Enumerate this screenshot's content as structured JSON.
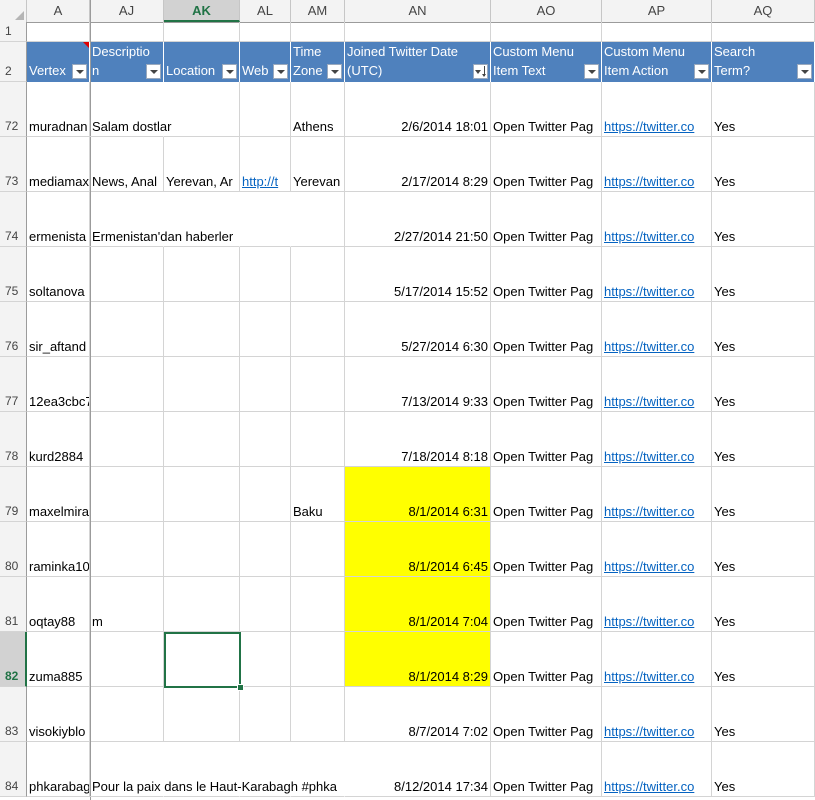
{
  "columns": [
    {
      "letter": "A",
      "selected": false
    },
    {
      "letter": "AJ",
      "selected": false
    },
    {
      "letter": "AK",
      "selected": true
    },
    {
      "letter": "AL",
      "selected": false
    },
    {
      "letter": "AM",
      "selected": false
    },
    {
      "letter": "AN",
      "selected": false
    },
    {
      "letter": "AO",
      "selected": false
    },
    {
      "letter": "AP",
      "selected": false
    },
    {
      "letter": "AQ",
      "selected": false
    }
  ],
  "row1_label": "1",
  "row2_label": "2",
  "headers": [
    {
      "label": "Vertex",
      "filter": true,
      "sorted": false
    },
    {
      "label": "Descriptio\nn",
      "filter": true,
      "sorted": false
    },
    {
      "label": "Location",
      "filter": true,
      "sorted": false
    },
    {
      "label": "Web",
      "filter": true,
      "sorted": false
    },
    {
      "label": "Time\nZone",
      "filter": true,
      "sorted": false
    },
    {
      "label": "Joined Twitter Date\n(UTC)",
      "filter": true,
      "sorted": true
    },
    {
      "label": "Custom Menu\nItem Text",
      "filter": true,
      "sorted": false
    },
    {
      "label": "Custom Menu\nItem Action",
      "filter": true,
      "sorted": false
    },
    {
      "label": "Tweeted Search\nTerm?",
      "filter": true,
      "sorted": false
    }
  ],
  "rows": [
    {
      "num": "72",
      "vertex": "muradnan",
      "description": "Salam dostlar",
      "location": "",
      "web": "",
      "timezone": "Athens",
      "joined": "2/6/2014 18:01",
      "menu_text": "Open Twitter Pag",
      "menu_action": "https://twitter.co",
      "tweeted": "Yes",
      "highlight": false
    },
    {
      "num": "73",
      "vertex": "mediamax",
      "description": "News, Anal",
      "location": "Yerevan, Ar",
      "web": "http://t",
      "timezone": "Yerevan",
      "joined": "2/17/2014 8:29",
      "menu_text": "Open Twitter Pag",
      "menu_action": "https://twitter.co",
      "tweeted": "Yes",
      "highlight": false
    },
    {
      "num": "74",
      "vertex": "ermenista",
      "description": "Ermenistan'dan haberler",
      "location": "",
      "web": "",
      "timezone": "",
      "joined": "2/27/2014 21:50",
      "menu_text": "Open Twitter Pag",
      "menu_action": "https://twitter.co",
      "tweeted": "Yes",
      "highlight": false
    },
    {
      "num": "75",
      "vertex": "soltanova",
      "description": "",
      "location": "",
      "web": "",
      "timezone": "",
      "joined": "5/17/2014 15:52",
      "menu_text": "Open Twitter Pag",
      "menu_action": "https://twitter.co",
      "tweeted": "Yes",
      "highlight": false
    },
    {
      "num": "76",
      "vertex": "sir_aftand",
      "description": "",
      "location": "",
      "web": "",
      "timezone": "",
      "joined": "5/27/2014 6:30",
      "menu_text": "Open Twitter Pag",
      "menu_action": "https://twitter.co",
      "tweeted": "Yes",
      "highlight": false
    },
    {
      "num": "77",
      "vertex": "12ea3cbc7",
      "description": "",
      "location": "",
      "web": "",
      "timezone": "",
      "joined": "7/13/2014 9:33",
      "menu_text": "Open Twitter Pag",
      "menu_action": "https://twitter.co",
      "tweeted": "Yes",
      "highlight": false
    },
    {
      "num": "78",
      "vertex": "kurd2884",
      "description": "",
      "location": "",
      "web": "",
      "timezone": "",
      "joined": "7/18/2014 8:18",
      "menu_text": "Open Twitter Pag",
      "menu_action": "https://twitter.co",
      "tweeted": "Yes",
      "highlight": false
    },
    {
      "num": "79",
      "vertex": "maxelmira",
      "description": "",
      "location": "",
      "web": "",
      "timezone": "Baku",
      "joined": "8/1/2014 6:31",
      "menu_text": "Open Twitter Pag",
      "menu_action": "https://twitter.co",
      "tweeted": "Yes",
      "highlight": true
    },
    {
      "num": "80",
      "vertex": "raminka10",
      "description": "",
      "location": "",
      "web": "",
      "timezone": "",
      "joined": "8/1/2014 6:45",
      "menu_text": "Open Twitter Pag",
      "menu_action": "https://twitter.co",
      "tweeted": "Yes",
      "highlight": true
    },
    {
      "num": "81",
      "vertex": "oqtay88",
      "description": "m",
      "location": "",
      "web": "",
      "timezone": "",
      "joined": "8/1/2014 7:04",
      "menu_text": "Open Twitter Pag",
      "menu_action": "https://twitter.co",
      "tweeted": "Yes",
      "highlight": true
    },
    {
      "num": "82",
      "vertex": "zuma885",
      "description": "",
      "location": "",
      "web": "",
      "timezone": "",
      "joined": "8/1/2014 8:29",
      "menu_text": "Open Twitter Pag",
      "menu_action": "https://twitter.co",
      "tweeted": "Yes",
      "highlight": true,
      "selected": true
    },
    {
      "num": "83",
      "vertex": "visokiyblo",
      "description": "",
      "location": "",
      "web": "",
      "timezone": "",
      "joined": "8/7/2014 7:02",
      "menu_text": "Open Twitter Pag",
      "menu_action": "https://twitter.co",
      "tweeted": "Yes",
      "highlight": false
    },
    {
      "num": "84",
      "vertex": "phkarabag",
      "description": "Pour la paix dans le Haut-Karabagh #phka",
      "location": "",
      "web": "",
      "timezone": "",
      "joined": "8/12/2014 17:34",
      "menu_text": "Open Twitter Pag",
      "menu_action": "https://twitter.co",
      "tweeted": "Yes",
      "highlight": false
    }
  ]
}
